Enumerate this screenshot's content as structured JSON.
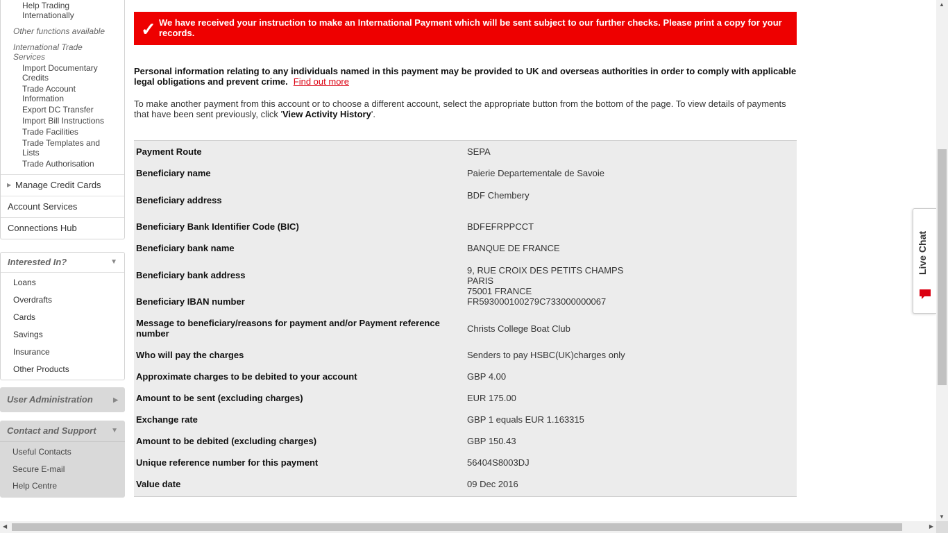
{
  "sidebar": {
    "help_trading": "Help Trading Internationally",
    "other_functions": "Other functions available",
    "intl_trade_services": "International Trade Services",
    "trade_items": [
      "Import Documentary Credits",
      "Trade Account Information",
      "Export DC Transfer",
      "Import Bill Instructions",
      "Trade Facilities",
      "Trade Templates and Lists",
      "Trade Authorisation"
    ],
    "manage_credit_cards": "Manage Credit Cards",
    "account_services": "Account Services",
    "connections_hub": "Connections Hub",
    "interested_in": {
      "title": "Interested In?",
      "items": [
        "Loans",
        "Overdrafts",
        "Cards",
        "Savings",
        "Insurance",
        "Other Products"
      ]
    },
    "user_admin": {
      "title": "User Administration"
    },
    "contact_support": {
      "title": "Contact and Support",
      "items": [
        "Useful Contacts",
        "Secure E-mail",
        "Help Centre"
      ]
    }
  },
  "alert": {
    "message": "We have received your instruction to make an International Payment which will be sent subject to our further checks. Please print a copy for your records.",
    "color": "#ee0000"
  },
  "info": {
    "privacy": "Personal information relating to any individuals named in this payment may be provided to UK and overseas authorities in order to comply with applicable legal obligations and prevent crime.",
    "find_out_more": "Find out more",
    "another_payment_prefix": "To make another payment from this account or to choose a different account, select the appropriate button from the bottom of the page. To view details of payments that have been sent previously, click '",
    "view_activity": "View Activity History",
    "another_payment_suffix": "'."
  },
  "details": [
    {
      "label": "Payment Route",
      "value": "SEPA"
    },
    {
      "label": "Beneficiary name",
      "value": "Paierie Departementale de Savoie"
    },
    {
      "label": "Beneficiary address",
      "value": "BDF Chembery"
    },
    {
      "label": "Beneficiary Bank Identifier Code (BIC)",
      "value": "BDFEFRPPCCT"
    },
    {
      "label": "Beneficiary bank name",
      "value": "BANQUE DE FRANCE"
    },
    {
      "label": "Beneficiary bank address",
      "value": "9, RUE CROIX DES PETITS CHAMPS\nPARIS\n75001 FRANCE"
    },
    {
      "label": "Beneficiary IBAN number",
      "value": "FR593000100279C733000000067"
    },
    {
      "label": "Message to beneficiary/reasons for payment and/or Payment reference number",
      "value": "Christs College Boat Club"
    },
    {
      "label": "Who will pay the charges",
      "value": "Senders to pay HSBC(UK)charges only"
    },
    {
      "label": "Approximate charges to be debited to your account",
      "value": "GBP 4.00"
    },
    {
      "label": "Amount to be sent (excluding charges)",
      "value": "EUR  175.00"
    },
    {
      "label": "Exchange rate",
      "value": "GBP 1 equals  EUR  1.163315"
    },
    {
      "label": "Amount to be debited (excluding charges)",
      "value": "GBP 150.43"
    },
    {
      "label": "Unique reference number for this payment",
      "value": "56404S8003DJ"
    },
    {
      "label": "Value date",
      "value": "09 Dec 2016"
    }
  ],
  "live_chat": {
    "label": "Live Chat"
  }
}
